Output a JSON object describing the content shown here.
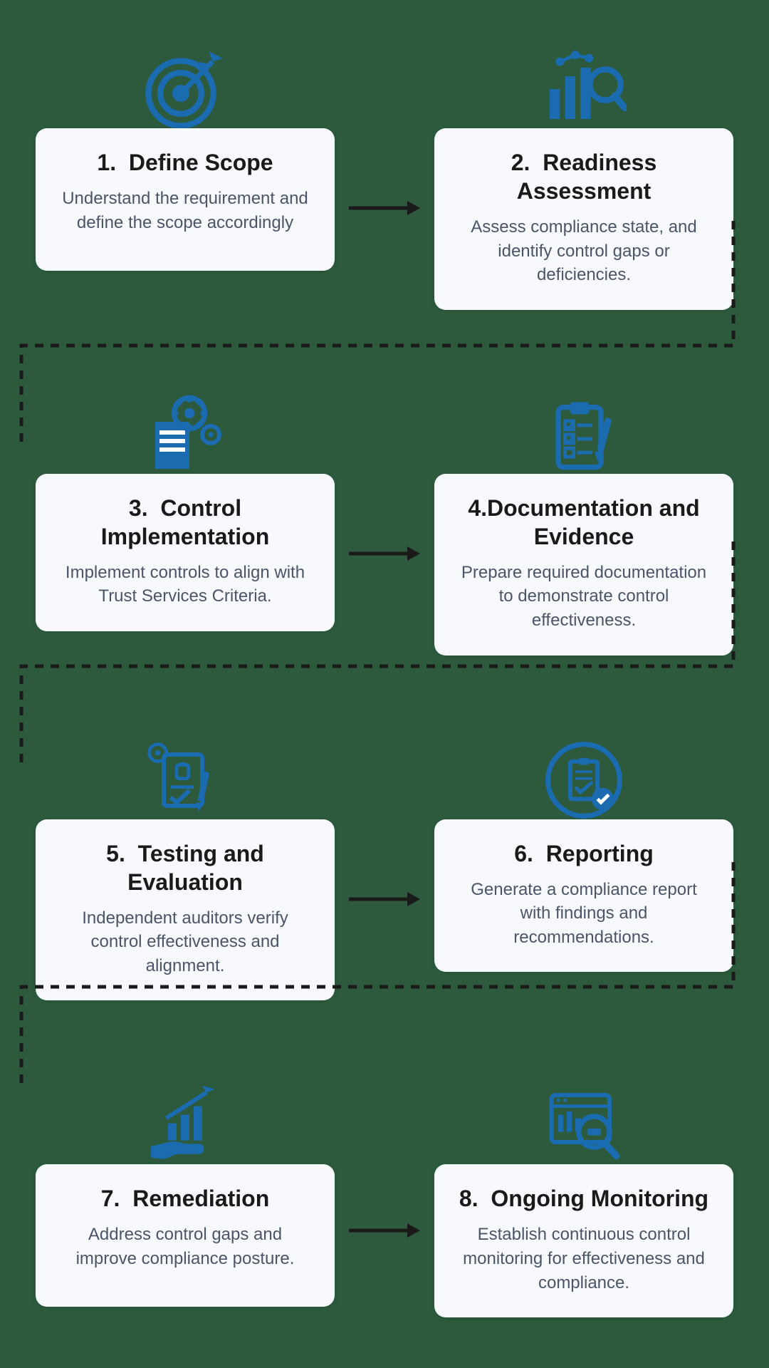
{
  "steps": [
    {
      "number": "1.",
      "title": "Define Scope",
      "desc": "Understand the requirement and define the scope accordingly",
      "icon": "target"
    },
    {
      "number": "2.",
      "title": "Readiness Assessment",
      "desc": "Assess compliance state, and identify control gaps or deficiencies.",
      "icon": "chart-magnify"
    },
    {
      "number": "3.",
      "title": "Control Implementation",
      "desc": "Implement controls to align with Trust Services Criteria.",
      "icon": "gear-doc"
    },
    {
      "number": "4.",
      "title": "Documentation and Evidence",
      "desc": "Prepare required documentation to demonstrate control effectiveness.",
      "icon": "checklist"
    },
    {
      "number": "5.",
      "title": "Testing and Evaluation",
      "desc": "Independent auditors verify control effectiveness and alignment.",
      "icon": "audit-doc"
    },
    {
      "number": "6.",
      "title": "Reporting",
      "desc": "Generate a compliance report with findings and recommendations.",
      "icon": "report-circle"
    },
    {
      "number": "7.",
      "title": "Remediation",
      "desc": "Address control gaps and improve compliance posture.",
      "icon": "growth-hand"
    },
    {
      "number": "8.",
      "title": "Ongoing Monitoring",
      "desc": "Establish continuous control monitoring for effectiveness and compliance.",
      "icon": "monitor-magnify"
    }
  ],
  "colors": {
    "iconBlue": "#1a6bb0",
    "arrowBlack": "#1a1a1a"
  }
}
